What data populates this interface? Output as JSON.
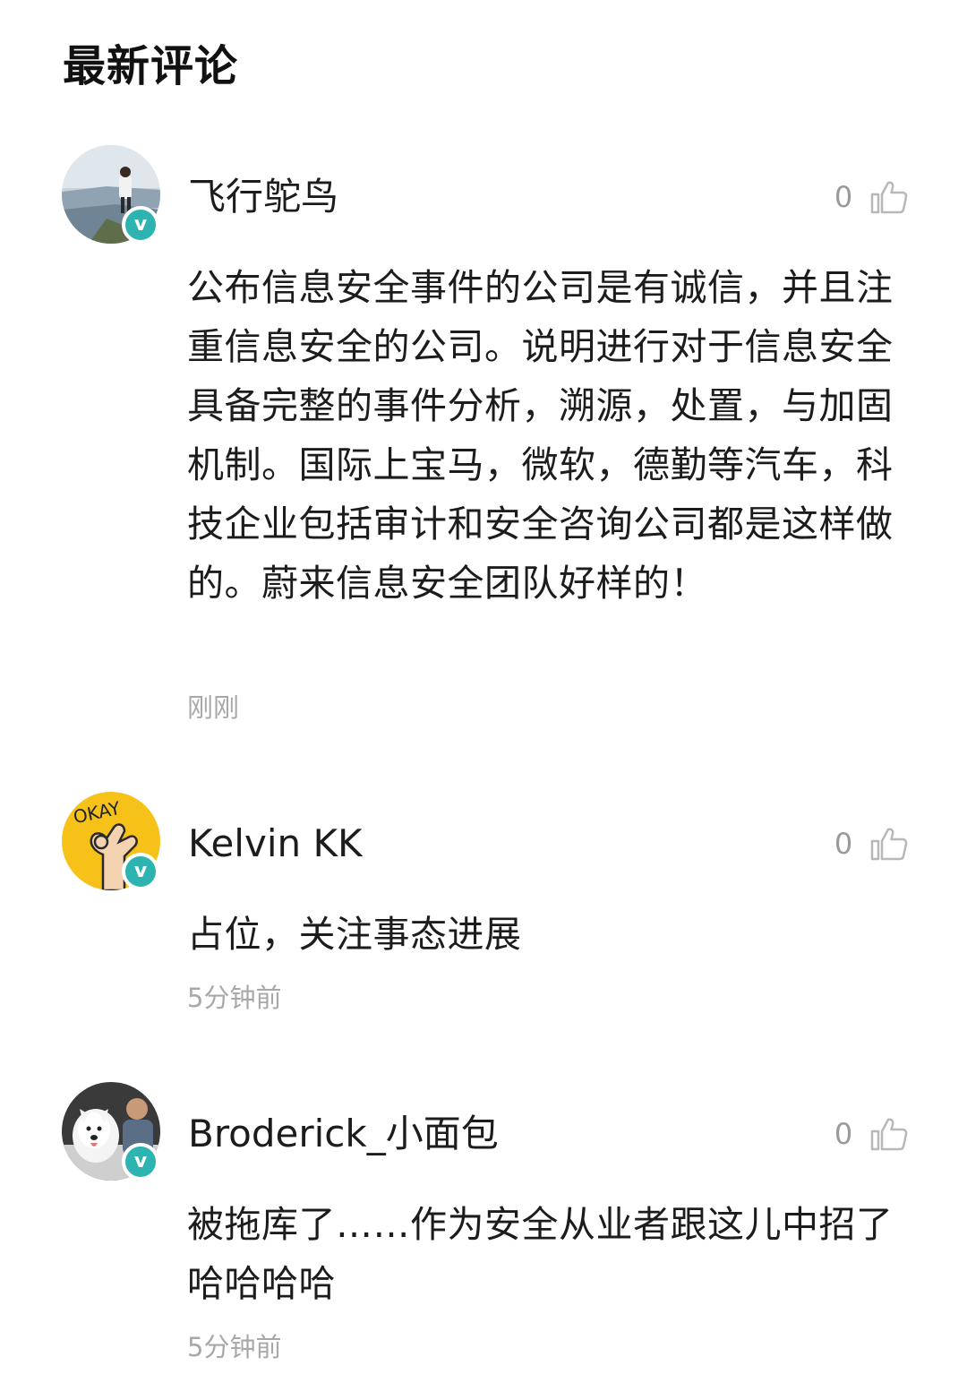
{
  "section_title": "最新评论",
  "comments": [
    {
      "username": "飞行鸵鸟",
      "verified_badge": "v",
      "likes": "0",
      "like_icon": "thumbs-up-icon",
      "text": "公布信息安全事件的公司是有诚信，并且注重信息安全的公司。说明进行对于信息安全具备完整的事件分析，溯源，处置，与加固机制。国际上宝马，微软，德勤等汽车，科技企业包括审计和安全咨询公司都是这样做的。蔚来信息安全团队好样的！",
      "time": "刚刚"
    },
    {
      "username": "Kelvin KK",
      "verified_badge": "v",
      "likes": "0",
      "like_icon": "thumbs-up-icon",
      "text": "占位，关注事态进展",
      "time": "5分钟前"
    },
    {
      "username": "Broderick_小面包",
      "verified_badge": "v",
      "likes": "0",
      "like_icon": "thumbs-up-icon",
      "text": "被拖库了……作为安全从业者跟这儿中招了哈哈哈哈",
      "time": "5分钟前"
    }
  ],
  "colors": {
    "verified": "#2db4b0",
    "muted_text": "#a8a8a8",
    "main_text": "#1c1c1c"
  }
}
